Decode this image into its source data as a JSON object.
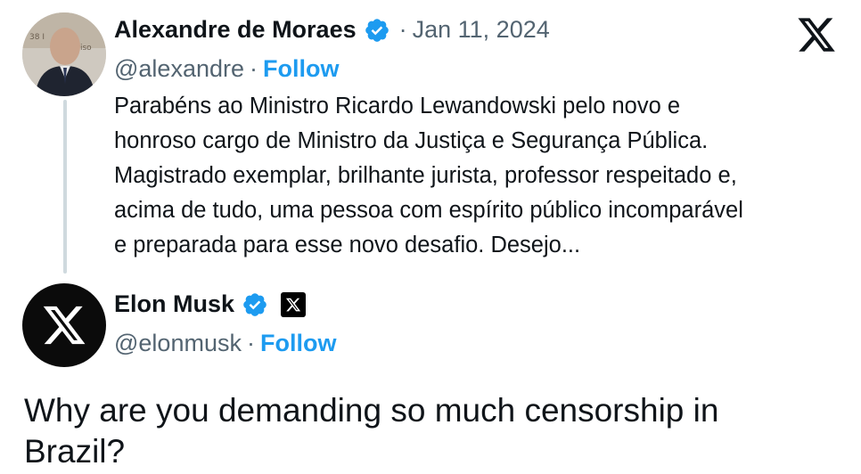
{
  "tweet1": {
    "name": "Alexandre de Moraes",
    "separator": "·",
    "date": "Jan 11, 2024",
    "handle": "@alexandre",
    "follow_label": "Follow",
    "lines": [
      "Parabéns ao Ministro Ricardo Lewandowski pelo novo e",
      "honroso cargo de Ministro da Justiça e Segurança Pública.",
      "Magistrado exemplar, brilhante jurista, professor respeitado e,",
      "acima de tudo, uma pessoa com espírito público incomparável",
      "e preparada para esse novo desafio. Desejo..."
    ]
  },
  "tweet2": {
    "name": "Elon Musk",
    "separator": "·",
    "handle": "@elonmusk",
    "follow_label": "Follow",
    "text_lines": [
      "Why are you demanding so much censorship in",
      "Brazil?"
    ]
  },
  "icons": {
    "x_logo": "x-logo-icon",
    "verified": "verified-badge-icon",
    "affiliate": "x-affiliate-badge-icon"
  },
  "colors": {
    "accent": "#1d9bf0",
    "secondary_text": "#536471",
    "thread_line": "#cfd9de"
  }
}
